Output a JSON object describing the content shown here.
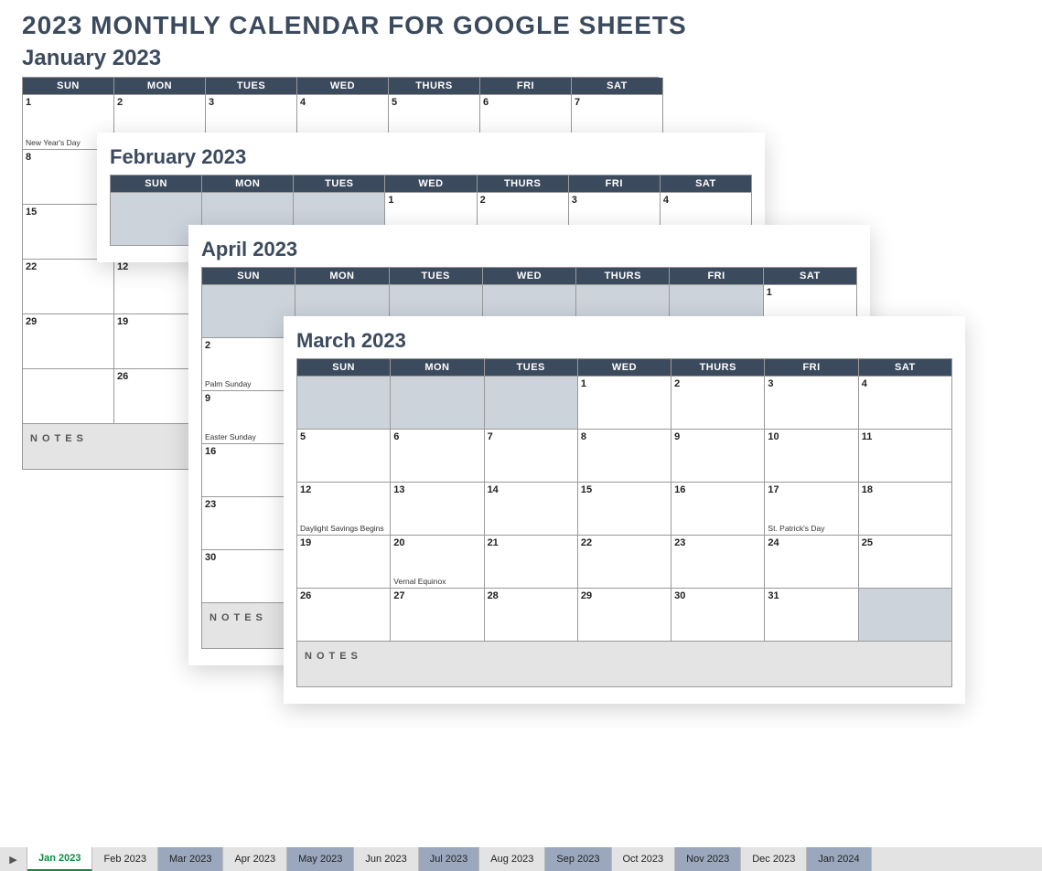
{
  "page_title": "2023 MONTHLY CALENDAR FOR GOOGLE SHEETS",
  "dow": [
    "SUN",
    "MON",
    "TUES",
    "WED",
    "THURS",
    "FRI",
    "SAT"
  ],
  "notes_label": "NOTES",
  "months": {
    "jan": {
      "title": "January 2023",
      "rows": [
        [
          {
            "n": "1",
            "e": "New Year's Day"
          },
          {
            "n": "2"
          },
          {
            "n": "3"
          },
          {
            "n": "4"
          },
          {
            "n": "5"
          },
          {
            "n": "6"
          },
          {
            "n": "7"
          }
        ],
        [
          {
            "n": "8"
          },
          {
            "n": ""
          },
          {
            "n": ""
          },
          {
            "n": ""
          },
          {
            "n": ""
          },
          {
            "n": ""
          },
          {
            "n": ""
          }
        ],
        [
          {
            "n": "15"
          },
          {
            "n": ""
          },
          {
            "n": ""
          },
          {
            "n": ""
          },
          {
            "n": ""
          },
          {
            "n": ""
          },
          {
            "n": ""
          }
        ],
        [
          {
            "n": "22"
          },
          {
            "n": "12"
          },
          {
            "n": ""
          },
          {
            "n": ""
          },
          {
            "n": ""
          },
          {
            "n": ""
          },
          {
            "n": ""
          }
        ],
        [
          {
            "n": "29"
          },
          {
            "n": "19"
          },
          {
            "n": ""
          },
          {
            "n": ""
          },
          {
            "n": ""
          },
          {
            "n": ""
          },
          {
            "n": ""
          }
        ]
      ],
      "extra_side": [
        {
          "n": "26"
        }
      ]
    },
    "feb": {
      "title": "February 2023",
      "rows": [
        [
          {
            "g": true
          },
          {
            "g": true
          },
          {
            "g": true
          },
          {
            "n": "1"
          },
          {
            "n": "2"
          },
          {
            "n": "3"
          },
          {
            "n": "4"
          }
        ]
      ]
    },
    "apr": {
      "title": "April 2023",
      "rows": [
        [
          {
            "g": true
          },
          {
            "g": true
          },
          {
            "g": true
          },
          {
            "g": true
          },
          {
            "g": true
          },
          {
            "g": true
          },
          {
            "n": "1"
          }
        ],
        [
          {
            "n": "2",
            "e": "Palm Sunday"
          },
          {
            "n": ""
          },
          {
            "n": ""
          },
          {
            "n": ""
          },
          {
            "n": ""
          },
          {
            "n": ""
          },
          {
            "n": ""
          }
        ],
        [
          {
            "n": "9",
            "e": "Easter Sunday"
          },
          {
            "n": ""
          },
          {
            "n": ""
          },
          {
            "n": ""
          },
          {
            "n": ""
          },
          {
            "n": ""
          },
          {
            "n": ""
          }
        ],
        [
          {
            "n": "16"
          },
          {
            "n": ""
          },
          {
            "n": ""
          },
          {
            "n": ""
          },
          {
            "n": ""
          },
          {
            "n": ""
          },
          {
            "n": ""
          }
        ],
        [
          {
            "n": "23"
          },
          {
            "n": ""
          },
          {
            "n": ""
          },
          {
            "n": ""
          },
          {
            "n": ""
          },
          {
            "n": ""
          },
          {
            "n": ""
          }
        ],
        [
          {
            "n": "30"
          },
          {
            "n": ""
          },
          {
            "n": ""
          },
          {
            "n": ""
          },
          {
            "n": ""
          },
          {
            "n": ""
          },
          {
            "n": ""
          }
        ]
      ]
    },
    "mar": {
      "title": "March 2023",
      "rows": [
        [
          {
            "g": true
          },
          {
            "g": true
          },
          {
            "g": true
          },
          {
            "n": "1"
          },
          {
            "n": "2"
          },
          {
            "n": "3"
          },
          {
            "n": "4"
          }
        ],
        [
          {
            "n": "5"
          },
          {
            "n": "6"
          },
          {
            "n": "7"
          },
          {
            "n": "8"
          },
          {
            "n": "9"
          },
          {
            "n": "10"
          },
          {
            "n": "11"
          }
        ],
        [
          {
            "n": "12",
            "e": "Daylight Savings Begins"
          },
          {
            "n": "13"
          },
          {
            "n": "14"
          },
          {
            "n": "15"
          },
          {
            "n": "16"
          },
          {
            "n": "17",
            "e": "St. Patrick's Day"
          },
          {
            "n": "18"
          }
        ],
        [
          {
            "n": "19"
          },
          {
            "n": "20",
            "e": "Vernal Equinox"
          },
          {
            "n": "21"
          },
          {
            "n": "22"
          },
          {
            "n": "23"
          },
          {
            "n": "24"
          },
          {
            "n": "25"
          }
        ],
        [
          {
            "n": "26"
          },
          {
            "n": "27"
          },
          {
            "n": "28"
          },
          {
            "n": "29"
          },
          {
            "n": "30"
          },
          {
            "n": "31"
          },
          {
            "g": true
          }
        ]
      ]
    }
  },
  "tabs": [
    {
      "label": "Jan 2023",
      "active": true
    },
    {
      "label": "Feb 2023"
    },
    {
      "label": "Mar 2023",
      "shaded": true
    },
    {
      "label": "Apr 2023"
    },
    {
      "label": "May 2023",
      "shaded": true
    },
    {
      "label": "Jun 2023"
    },
    {
      "label": "Jul 2023",
      "shaded": true
    },
    {
      "label": "Aug 2023"
    },
    {
      "label": "Sep 2023",
      "shaded": true
    },
    {
      "label": "Oct 2023"
    },
    {
      "label": "Nov 2023",
      "shaded": true
    },
    {
      "label": "Dec 2023"
    },
    {
      "label": "Jan 2024",
      "shaded": true
    }
  ]
}
